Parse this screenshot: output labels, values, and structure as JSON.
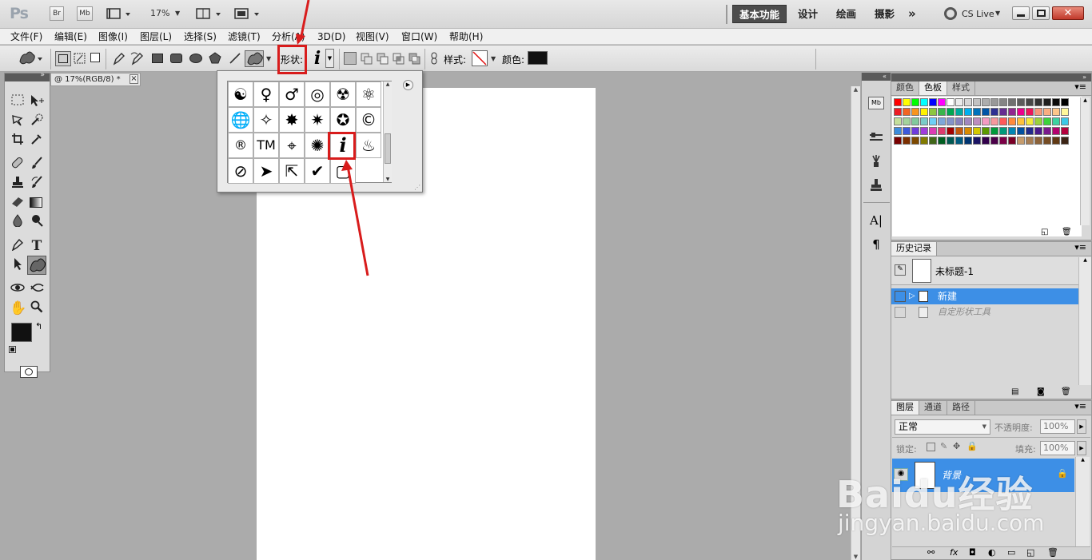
{
  "app": {
    "logo": "Ps",
    "bridge_label": "Br",
    "minibridge_label": "Mb",
    "zoom": "17%",
    "workspaces": [
      "基本功能",
      "设计",
      "绘画",
      "摄影"
    ],
    "more_label": "»",
    "cs_live": "CS Live"
  },
  "menu": {
    "items": [
      "文件(F)",
      "编辑(E)",
      "图像(I)",
      "图层(L)",
      "选择(S)",
      "滤镜(T)",
      "分析(A)",
      "3D(D)",
      "视图(V)",
      "窗口(W)",
      "帮助(H)"
    ]
  },
  "options": {
    "shape_label": "形状:",
    "shape_value": "i",
    "style_label": "样式:",
    "color_label": "颜色:",
    "color_value": "#111111"
  },
  "document": {
    "tab_title": "@ 17%(RGB/8) *",
    "close": "×"
  },
  "shape_picker": {
    "shapes": [
      "☯",
      "♀",
      "♂",
      "◎",
      "☢",
      "⚛",
      "🌐",
      "✧",
      "✸",
      "✷",
      "✪",
      "©",
      "®",
      "TM",
      "⌖",
      "✺",
      "i",
      "♨",
      "⊘",
      "➤",
      "⇱",
      "✔",
      "▢"
    ]
  },
  "panels": {
    "swatches": {
      "tabs": [
        "颜色",
        "色板",
        "样式"
      ],
      "active_tab": "色板",
      "colors": [
        [
          "#ff0000",
          "#ffff00",
          "#00ff00",
          "#00ffff",
          "#0000ff",
          "#ff00ff",
          "#ffffff",
          "#ebebeb",
          "#d6d6d6",
          "#c2c2c2",
          "#adadad",
          "#999999",
          "#858585",
          "#707070",
          "#5c5c5c",
          "#474747",
          "#333333",
          "#1f1f1f",
          "#0a0a0a",
          "#000000"
        ],
        [
          "#ed1c24",
          "#f26522",
          "#f7941d",
          "#fff200",
          "#8dc63f",
          "#39b54a",
          "#00a651",
          "#00a99d",
          "#00aeef",
          "#0072bc",
          "#0054a6",
          "#2e3192",
          "#662d91",
          "#92278f",
          "#ec008c",
          "#ed145b",
          "#f7977a",
          "#f9ad81",
          "#fdc68a",
          "#fff79a"
        ],
        [
          "#c4df9b",
          "#a3d39c",
          "#82ca9d",
          "#7accc8",
          "#6dcff6",
          "#7da7d9",
          "#8393ca",
          "#8781bd",
          "#a187be",
          "#bc8dbf",
          "#f49ac2",
          "#f6989d",
          "#ff5a5a",
          "#ff8a3c",
          "#ffc13c",
          "#f5e93c",
          "#9ad23c",
          "#3cd23c",
          "#3cd2a0",
          "#3cc8e6"
        ],
        [
          "#3c8cdc",
          "#3c5adc",
          "#6e3cdc",
          "#a03cdc",
          "#dc3cb4",
          "#dc3c6e",
          "#a40000",
          "#c4580c",
          "#d88a00",
          "#d4c800",
          "#5a9a00",
          "#009a3a",
          "#009a7a",
          "#0086b4",
          "#0050a0",
          "#202a8c",
          "#4a1a8c",
          "#7a1a8c",
          "#b4006e",
          "#b4003c"
        ],
        [
          "#790000",
          "#7b2e00",
          "#7d4900",
          "#827b00",
          "#406618",
          "#005e20",
          "#005952",
          "#005b7f",
          "#003471",
          "#1b1464",
          "#32004b",
          "#4b0049",
          "#7b0046",
          "#7a0026",
          "#c69c6d",
          "#a67c52",
          "#8c6239",
          "#754c24",
          "#603913",
          "#3c2415"
        ]
      ]
    },
    "history": {
      "title": "历史记录",
      "snapshot": "未标题-1",
      "items": [
        "新建",
        "自定形状工具"
      ]
    },
    "layers": {
      "tabs": [
        "图层",
        "通道",
        "路径"
      ],
      "blend_mode": "正常",
      "opacity_label": "不透明度:",
      "opacity_value": "100%",
      "lock_label": "锁定:",
      "fill_label": "填充:",
      "fill_value": "100%",
      "layer_name": "背景"
    }
  },
  "watermark": {
    "brand": "Baidu经验",
    "url": "jingyan.baidu.com"
  }
}
